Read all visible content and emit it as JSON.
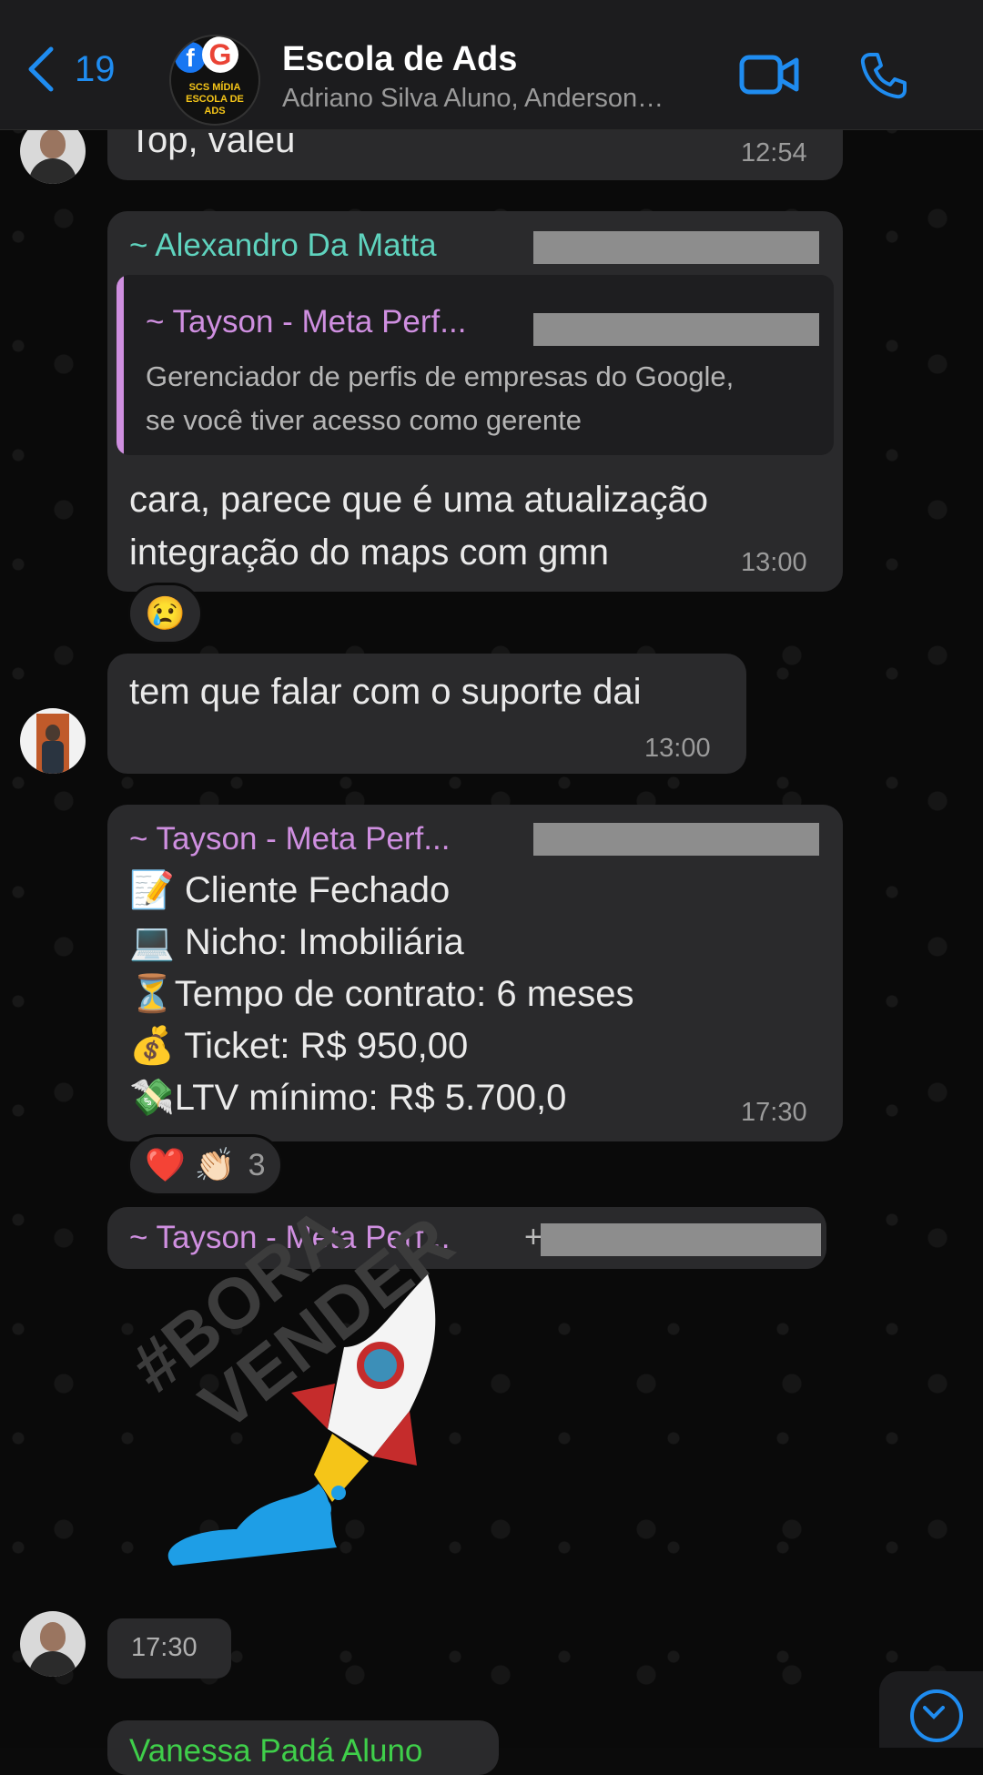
{
  "header": {
    "back_count": "19",
    "title": "Escola de Ads",
    "subtitle": "Adriano Silva Aluno, Anderson…",
    "avatar_brand_top": "SCS MÍDIA",
    "avatar_brand_bottom": "ESCOLA DE ADS",
    "accent_color": "#1f8cf0"
  },
  "messages": [
    {
      "text": "Top, valeu",
      "time": "12:54"
    },
    {
      "sender": "~ Alexandro Da Matta",
      "quote_sender": "~ Tayson - Meta Perf...",
      "quote_line1": "Gerenciador de perfis de empresas do Google,",
      "quote_line2": "se você tiver acesso como gerente",
      "line1": "cara, parece que é uma atualização",
      "line2": "integração do maps com gmn",
      "time": "13:00",
      "reaction": "😢"
    },
    {
      "text": "tem que falar com o suporte dai",
      "time": "13:00"
    },
    {
      "sender": "~ Tayson - Meta Perf...",
      "lines": [
        "📝 Cliente Fechado",
        "💻 Nicho: Imobiliária",
        "⏳Tempo de contrato: 6 meses",
        "💰 Ticket: R$ 950,00",
        "💸LTV mínimo: R$ 5.700,0"
      ],
      "time": "17:30",
      "reaction_emojis": "❤️ 👏🏻",
      "reaction_count": "3"
    },
    {
      "sender": "~ Tayson - Meta Perf...",
      "plus": "+",
      "sticker_text_line1": "#BORA",
      "sticker_text_line2": "VENDER",
      "time": "17:30"
    },
    {
      "sender": "Vanessa Padá Aluno"
    }
  ]
}
